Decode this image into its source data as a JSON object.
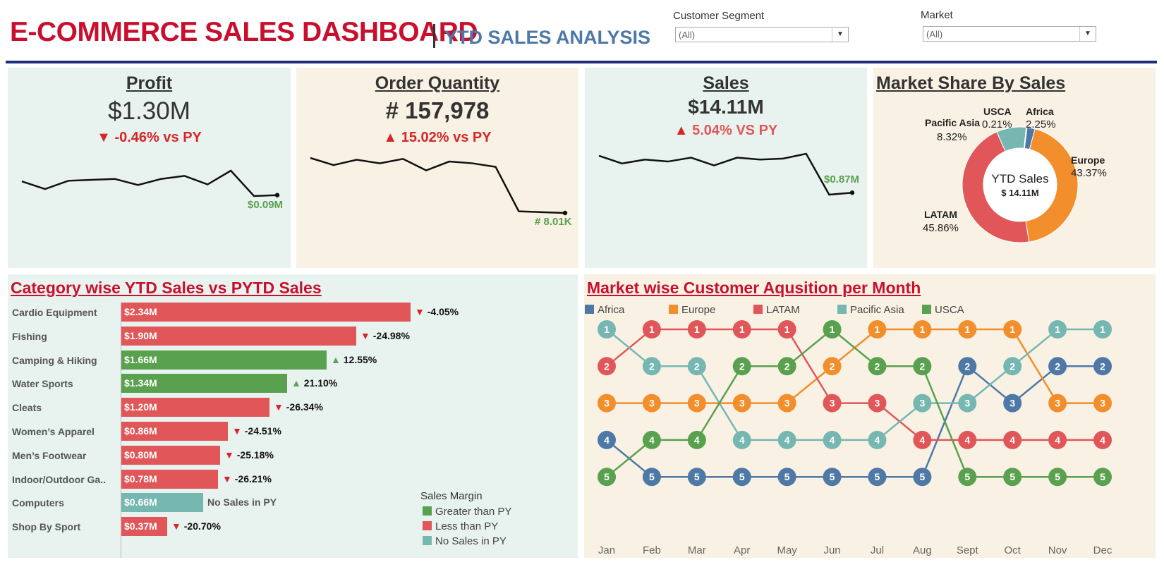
{
  "header": {
    "title": "E-COMMERCE SALES DASHBOARD",
    "subtitle": "YTD SALES ANALYSIS"
  },
  "filters": {
    "segment_label": "Customer Segment",
    "segment_value": "(All)",
    "market_label": "Market",
    "market_value": "(All)"
  },
  "kpis": {
    "profit": {
      "title": "Profit",
      "value": "$1.30M",
      "delta": "-0.46% vs PY",
      "direction": "down",
      "last_label": "$0.09M",
      "trend": [
        6,
        3.5,
        6.2,
        6.5,
        6.8,
        4.8,
        6.8,
        7.8,
        5,
        9.5,
        1.2,
        1.5
      ]
    },
    "orders": {
      "title": "Order Quantity",
      "value": "# 157,978",
      "delta": "15.02% vs PY",
      "direction": "up",
      "last_label": "# 8.01K",
      "trend": [
        14.2,
        13.4,
        14.0,
        13.6,
        14.1,
        12.8,
        13.8,
        13.6,
        13.2,
        8.2,
        8.1,
        8.01
      ]
    },
    "sales": {
      "title": "Sales",
      "value": "$14.11M",
      "delta": "5.04%  VS PY",
      "direction": "up",
      "last_label": "$0.87M",
      "trend": [
        1.25,
        1.17,
        1.21,
        1.19,
        1.23,
        1.15,
        1.23,
        1.21,
        1.22,
        1.27,
        0.85,
        0.87
      ]
    }
  },
  "donut": {
    "title": "Market Share By Sales",
    "center_title": "YTD Sales",
    "center_value": "$ 14.11M",
    "colors": {
      "Africa": "#4e79a7",
      "Europe": "#f28e2b",
      "LATAM": "#e15759",
      "Pacific Asia": "#76b7b2",
      "USCA": "#59a14f"
    }
  },
  "category": {
    "title": "Category wise YTD Sales vs PYTD Sales",
    "legend_title": "Sales Margin",
    "legend": [
      "Greater than PY",
      "Less than PY",
      "No Sales in PY"
    ],
    "colors": {
      "Greater than PY": "#59a14f",
      "Less than PY": "#e15759",
      "No Sales in PY": "#76b7b2"
    }
  },
  "bump": {
    "title": "Market wise Customer Aqusition per Month",
    "legend": [
      "Africa",
      "Europe",
      "LATAM",
      "Pacific Asia",
      "USCA"
    ],
    "colors": {
      "Africa": "#4e79a7",
      "Europe": "#f28e2b",
      "LATAM": "#e15759",
      "Pacific Asia": "#76b7b2",
      "USCA": "#59a14f"
    }
  },
  "chart_data": [
    {
      "type": "pie",
      "title": "Market Share By Sales",
      "categories": [
        "Africa",
        "Europe",
        "LATAM",
        "Pacific Asia",
        "USCA"
      ],
      "values": [
        2.25,
        43.37,
        45.86,
        8.32,
        0.21
      ],
      "labels": [
        "2.25%",
        "43.37%",
        "45.86%",
        "8.32%",
        "0.21%"
      ]
    },
    {
      "type": "bar",
      "title": "Category wise YTD Sales vs PYTD Sales",
      "categories": [
        "Cardio Equipment",
        "Fishing",
        "Camping & Hiking",
        "Water Sports",
        "Cleats",
        "Women’s Apparel",
        "Men’s Footwear",
        "Indoor/Outdoor Ga..",
        "Computers",
        "Shop By Sport"
      ],
      "values": [
        2.34,
        1.9,
        1.66,
        1.34,
        1.2,
        0.86,
        0.8,
        0.78,
        0.66,
        0.37
      ],
      "value_labels": [
        "$2.34M",
        "$1.90M",
        "$1.66M",
        "$1.34M",
        "$1.20M",
        "$0.86M",
        "$0.80M",
        "$0.78M",
        "$0.66M",
        "$0.37M"
      ],
      "delta_labels": [
        "-4.05%",
        "-24.98%",
        "12.55%",
        "21.10%",
        "-26.34%",
        "-24.51%",
        "-25.18%",
        "-26.21%",
        "No Sales in PY",
        "-20.70%"
      ],
      "margin": [
        "Less than PY",
        "Less than PY",
        "Greater than PY",
        "Greater than PY",
        "Less than PY",
        "Less than PY",
        "Less than PY",
        "Less than PY",
        "No Sales in PY",
        "Less than PY"
      ]
    },
    {
      "type": "line",
      "title": "Market wise Customer Aqusition per Month",
      "x": [
        "Jan",
        "Feb",
        "Mar",
        "Apr",
        "May",
        "Jun",
        "Jul",
        "Aug",
        "Sept",
        "Oct",
        "Nov",
        "Dec"
      ],
      "ylim": [
        5,
        1
      ],
      "series": [
        {
          "name": "Africa",
          "values": [
            4,
            5,
            5,
            5,
            5,
            5,
            5,
            5,
            2,
            3,
            2,
            2
          ]
        },
        {
          "name": "Europe",
          "values": [
            3,
            3,
            3,
            3,
            3,
            2,
            1,
            1,
            1,
            1,
            3,
            3
          ]
        },
        {
          "name": "LATAM",
          "values": [
            2,
            1,
            1,
            1,
            1,
            3,
            3,
            4,
            4,
            4,
            4,
            4
          ]
        },
        {
          "name": "Pacific Asia",
          "values": [
            1,
            2,
            2,
            4,
            4,
            4,
            4,
            3,
            3,
            2,
            1,
            1
          ]
        },
        {
          "name": "USCA",
          "values": [
            5,
            4,
            4,
            2,
            2,
            1,
            2,
            2,
            5,
            5,
            5,
            5
          ]
        }
      ]
    }
  ]
}
